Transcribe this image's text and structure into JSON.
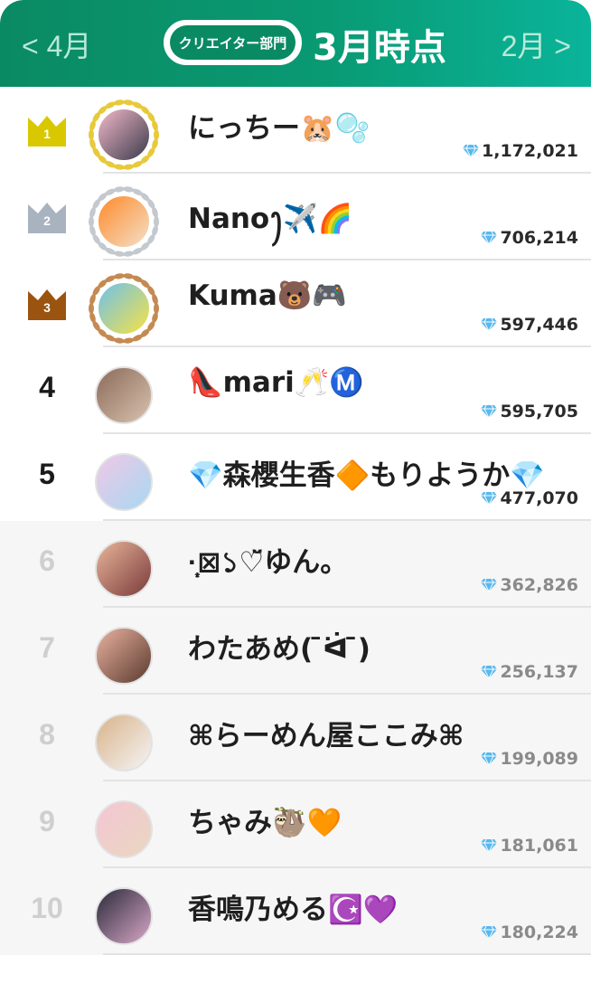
{
  "header": {
    "prev_label": "< 4月",
    "next_label": "2月 >",
    "category_label": "クリエイター部門",
    "title": "3月時点"
  },
  "colors": {
    "header_start": "#0a8a63",
    "header_end": "#0ab49a",
    "gold": "#d9c800",
    "silver": "#a9b3c0",
    "bronze": "#9a5410",
    "gem": "#58b8ee"
  },
  "rankings": [
    {
      "rank": "1",
      "name": "にっちー🐹🫧",
      "score": "1,172,021",
      "medal": "gold",
      "avatar": [
        "#f2b9c9",
        "#3a3a4a"
      ]
    },
    {
      "rank": "2",
      "name": "Nanoꫂ✈️🌈",
      "score": "706,214",
      "medal": "silver",
      "avatar": [
        "#ff8a2a",
        "#f3e0c8"
      ]
    },
    {
      "rank": "3",
      "name": "Kuma🐻🎮",
      "score": "597,446",
      "medal": "bronze",
      "avatar": [
        "#6ec1ea",
        "#f7e245"
      ]
    },
    {
      "rank": "4",
      "name": "👠mari🥂Ⓜ️",
      "score": "595,705",
      "medal": "",
      "avatar": [
        "#8c6a5a",
        "#d8c2ae"
      ]
    },
    {
      "rank": "5",
      "name": "💎森櫻生香🔶もりようか💎",
      "score": "477,070",
      "medal": "",
      "avatar": [
        "#f0c8e8",
        "#a7d8f0"
      ]
    },
    {
      "rank": "6",
      "name": "·̩͙⊠১♡̆̈ゆん。",
      "score": "362,826",
      "medal": "",
      "avatar": [
        "#e8b59a",
        "#7a3a3a"
      ]
    },
    {
      "rank": "7",
      "name": "わたあめ( ̄ᐛ ̄)",
      "score": "256,137",
      "medal": "",
      "avatar": [
        "#e9b2a0",
        "#5a3a2e"
      ]
    },
    {
      "rank": "8",
      "name": "⌘らーめん屋ここみ⌘",
      "score": "199,089",
      "medal": "",
      "avatar": [
        "#d9b38a",
        "#f4f4f4"
      ]
    },
    {
      "rank": "9",
      "name": "ちゃみ🦥🧡",
      "score": "181,061",
      "medal": "",
      "avatar": [
        "#f4c6d4",
        "#e9d7c0"
      ]
    },
    {
      "rank": "10",
      "name": "香鳴乃める☪️💜",
      "score": "180,224",
      "medal": "",
      "avatar": [
        "#2a2a3a",
        "#d9a7c7"
      ]
    }
  ]
}
